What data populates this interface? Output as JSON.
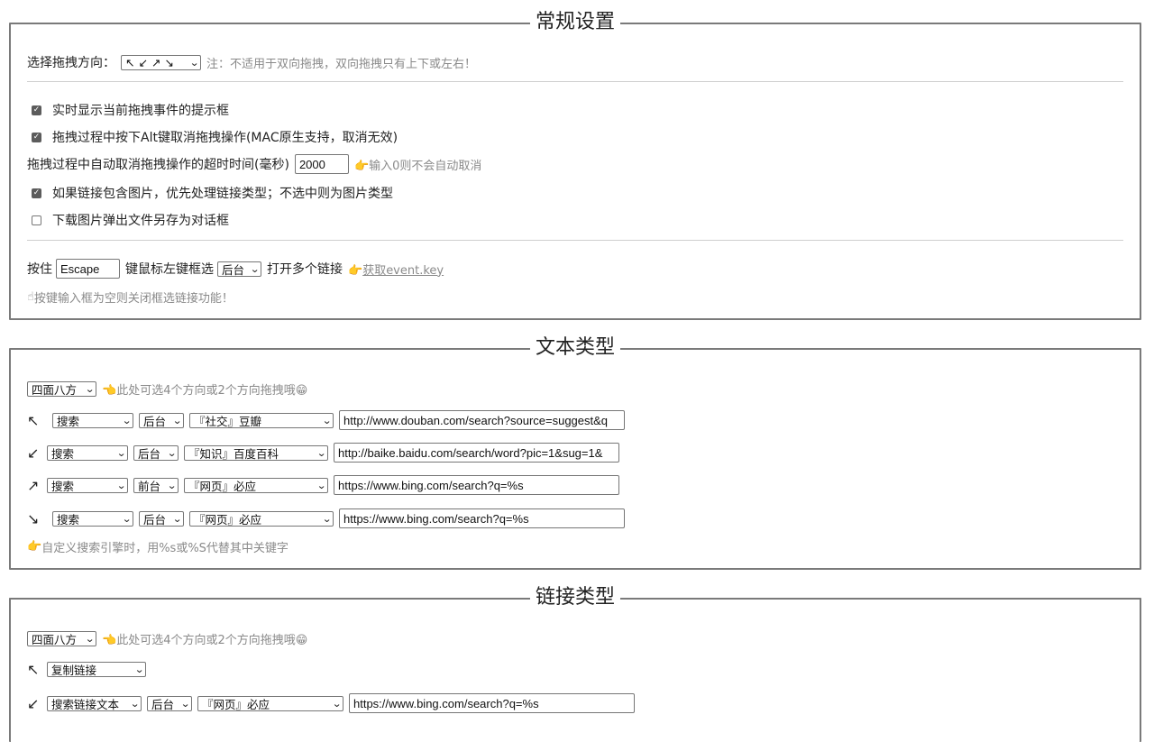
{
  "general": {
    "legend": "常规设置",
    "direction_label": "选择拖拽方向：",
    "direction_value": "↖ ↙ ↗ ↘",
    "direction_note": "注：不适用于双向拖拽，双向拖拽只有上下或左右！",
    "opt_show_tip": "实时显示当前拖拽事件的提示框",
    "opt_show_tip_checked": true,
    "opt_alt_cancel": "拖拽过程中按下Alt键取消拖拽操作(MAC原生支持，取消无效)",
    "opt_alt_cancel_checked": true,
    "timeout_label": "拖拽过程中自动取消拖拽操作的超时时间(毫秒)",
    "timeout_value": "2000",
    "timeout_note": "输入0则不会自动取消",
    "opt_link_priority": "如果链接包含图片，优先处理链接类型；不选中则为图片类型",
    "opt_link_priority_checked": true,
    "opt_save_dialog": "下载图片弹出文件另存为对话框",
    "opt_save_dialog_checked": false,
    "hold_label": "按住",
    "hold_key": "Escape",
    "hold_mid": "键鼠标左键框选",
    "hold_mode": "后台",
    "hold_tail": "打开多个链接",
    "event_key_link": "获取event.key",
    "hold_note": "按键输入框为空则关闭框选链接功能！"
  },
  "text_type": {
    "legend": "文本类型",
    "mode": "四面八方",
    "mode_note": "此处可选4个方向或2个方向拖拽哦",
    "rows": [
      {
        "dir": "↖",
        "action": "搜索",
        "tab": "后台",
        "engine": "『社交』豆瓣",
        "url": "http://www.douban.com/search?source=suggest&q"
      },
      {
        "dir": "↙",
        "action": "搜索",
        "tab": "后台",
        "engine": "『知识』百度百科",
        "url": "http://baike.baidu.com/search/word?pic=1&sug=1&"
      },
      {
        "dir": "↗",
        "action": "搜索",
        "tab": "前台",
        "engine": "『网页』必应",
        "url": "https://www.bing.com/search?q=%s"
      },
      {
        "dir": "↘",
        "action": "搜索",
        "tab": "后台",
        "engine": "『网页』必应",
        "url": "https://www.bing.com/search?q=%s"
      }
    ],
    "footer_note": "自定义搜索引擎时，用%s或%S代替其中关键字"
  },
  "link_type": {
    "legend": "链接类型",
    "mode": "四面八方",
    "mode_note": "此处可选4个方向或2个方向拖拽哦",
    "row1": {
      "dir": "↖",
      "action": "复制链接"
    },
    "row2": {
      "dir": "↙",
      "action": "搜索链接文本",
      "tab": "后台",
      "engine": "『网页』必应",
      "url": "https://www.bing.com/search?q=%s"
    }
  },
  "icons": {
    "pointing": "👉",
    "pointing_left": "👈",
    "grin": "😁",
    "index_up": "☝"
  },
  "colors": {
    "border": "#7a7a7a",
    "note": "#8a8a8a",
    "checked": "#5c5c5c"
  }
}
